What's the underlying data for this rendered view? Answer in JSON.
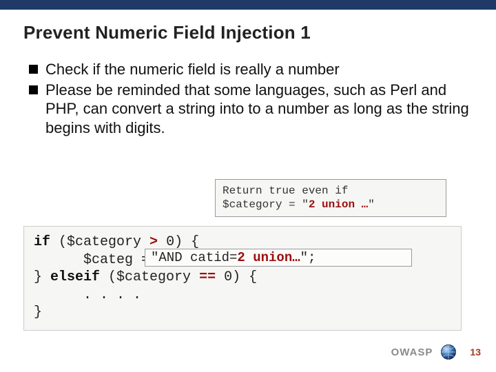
{
  "title": "Prevent Numeric Field Injection 1",
  "bullets": [
    "Check if the numeric field is really a number",
    "Please be reminded that some languages, such as Perl and PHP, can convert a string into to a number as long as the string begins with digits."
  ],
  "note": {
    "prefix": "Return true even if\n$category = \"",
    "highlight": "2 union …",
    "suffix": "\""
  },
  "code": {
    "line1_a": "if ($category ",
    "line1_op": ">",
    "line1_b": " 0) {",
    "line2": "      $categ = ",
    "line3_a": "} ",
    "line3_kw": "elseif",
    "line3_b": " ($category ",
    "line3_op": "==",
    "line3_c": " 0) {",
    "line4": "      . . . .",
    "line5": "}"
  },
  "callout": {
    "prefix": "\"AND catid=",
    "highlight": "2 union…",
    "suffix": "\";"
  },
  "footer": {
    "org": "OWASP",
    "page": "13"
  }
}
